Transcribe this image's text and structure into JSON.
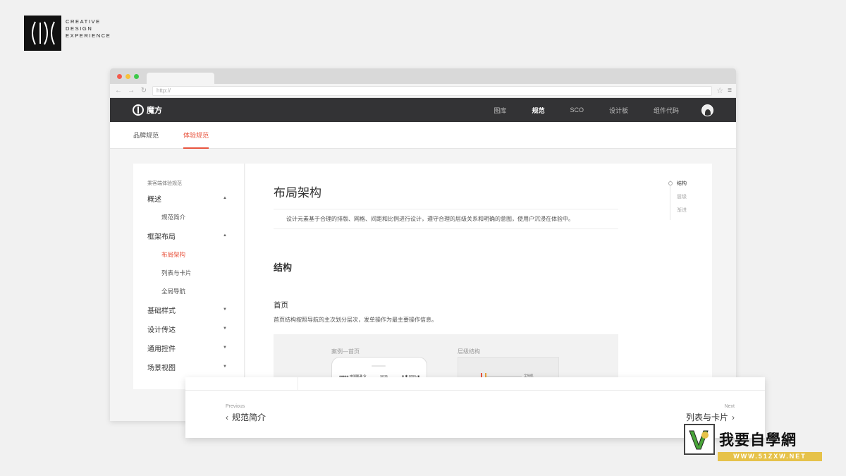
{
  "brand": {
    "mark": "(I)(",
    "lines": [
      "CREATIVE",
      "DESIGN",
      "EXPERIENCE"
    ]
  },
  "browser": {
    "url": "http://"
  },
  "app": {
    "logo_text": "魔方",
    "nav": [
      {
        "label": "图库"
      },
      {
        "label": "规范"
      },
      {
        "label": "SCO"
      },
      {
        "label": "设计板"
      },
      {
        "label": "组件代码"
      }
    ],
    "active_nav": "规范"
  },
  "subtabs": [
    {
      "label": "品牌规范"
    },
    {
      "label": "体验规范"
    }
  ],
  "sidebar": {
    "caption": "乘客端体验规范",
    "groups": [
      {
        "label": "概述",
        "arrow": "▲"
      },
      {
        "label": "框架布局",
        "arrow": "▲"
      },
      {
        "label": "基础样式",
        "arrow": "▼"
      },
      {
        "label": "设计传达",
        "arrow": "▼"
      },
      {
        "label": "通用控件",
        "arrow": "▼"
      },
      {
        "label": "场景视图",
        "arrow": "▼"
      }
    ],
    "subs": [
      {
        "label": "规范简介"
      },
      {
        "label": "布局架构"
      },
      {
        "label": "列表与卡片"
      },
      {
        "label": "全局导航"
      }
    ]
  },
  "doc": {
    "title": "布局架构",
    "lead": "设计元素基于合理的排版、网格、间距和比例进行设计，遵守合理的层级关系和明确的意图，使用户沉浸在体验中。",
    "section": "结构",
    "subsection": "首页",
    "desc": "首页结构按照导航的主次划分层次，发单操作为最主要操作信息。",
    "preview_left": "案例—首页",
    "preview_right": "层级结构",
    "phone_status_left": "●●●●● 中国联通 令",
    "phone_status_mid": "18:31",
    "phone_status_right": "⊕ ✱ 100% ■",
    "diagram_label": "全局航"
  },
  "toc": [
    {
      "label": "结构"
    },
    {
      "label": "层级"
    },
    {
      "label": "渐进"
    }
  ],
  "pager": {
    "prev_caption": "Previous",
    "prev_title": "规范简介",
    "next_caption": "Next",
    "next_title": "列表与卡片"
  },
  "watermark": {
    "text": "我要自學網",
    "url": "WWW.51ZXW.NET"
  },
  "colors": {
    "accent": "#e8543e",
    "appbar": "#333335"
  }
}
